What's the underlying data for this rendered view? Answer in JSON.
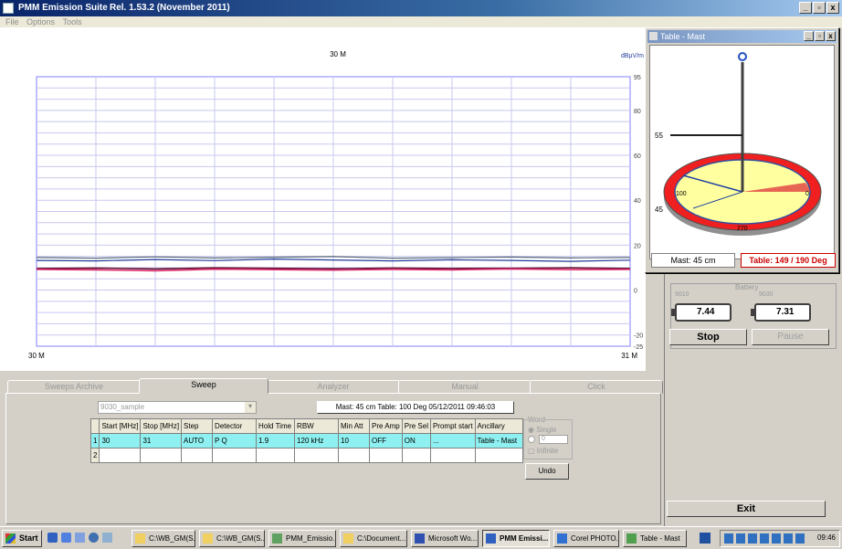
{
  "window": {
    "title": "PMM Emission Suite",
    "release": "Rel. 1.53.2 (November 2011)"
  },
  "menu": [
    "File",
    "Options",
    "Tools"
  ],
  "chart": {
    "top_center_label": "30 M",
    "unit_label": "dBµV/m",
    "y_ticks": [
      "95",
      "80",
      "60",
      "40",
      "20",
      "0",
      "-20",
      "-25"
    ],
    "x_start_label": "30 M",
    "x_end_label": "31 M",
    "colors": {
      "grid": "#8080ff",
      "hgrid": "#c8c8f0",
      "trace_gray": "#5a6a7a",
      "trace_blue": "#203a9a",
      "trace_dark": "#601030",
      "trace_red": "#e03070"
    }
  },
  "chart_data": {
    "type": "line",
    "xlim": [
      30,
      31
    ],
    "ylim": [
      -25,
      95
    ],
    "x": [
      30,
      30.1,
      30.2,
      30.3,
      30.4,
      30.5,
      30.6,
      30.7,
      30.8,
      30.9,
      31
    ],
    "series": [
      {
        "values": [
          14.5,
          14.2,
          14.8,
          14.3,
          14.6,
          14.9,
          14.2,
          14.4,
          14.7,
          14.3,
          14.5
        ]
      },
      {
        "values": [
          13.2,
          13.0,
          13.6,
          13.1,
          13.8,
          13.4,
          13.0,
          13.5,
          13.2,
          12.8,
          13.3
        ]
      },
      {
        "values": [
          9.6,
          9.8,
          9.4,
          9.9,
          9.7,
          9.5,
          9.8,
          9.6,
          9.7,
          9.9,
          9.6
        ]
      },
      {
        "values": [
          9.2,
          9.0,
          8.6,
          9.3,
          9.1,
          8.9,
          9.2,
          9.0,
          9.4,
          9.1,
          9.2
        ]
      }
    ]
  },
  "table_mast": {
    "window_title": "Table - Mast",
    "mast_top_label": "55",
    "mast_bottom_label": "45",
    "table_left_label": "100",
    "table_right_label": "0",
    "table_bottom_label": "270",
    "mast_readout": "Mast: 45 cm",
    "table_readout": "Table: 149 / 190 Deg",
    "colors": {
      "disc_outer": "#f02020",
      "disc_inner": "#ffffa0",
      "readout_red": "#cc0000"
    }
  },
  "right_panel": {
    "battery_label": "Battery",
    "battery_a_label": "9010",
    "battery_a_value": "7.44",
    "battery_b_label": "9030",
    "battery_b_value": "7.31",
    "stop_label": "Stop",
    "pause_label": "Pause",
    "exit_label": "Exit"
  },
  "tabs": [
    "Sweeps Archive",
    "Sweep",
    "Analyzer",
    "Manual",
    "Click"
  ],
  "active_tab": "Sweep",
  "sweep": {
    "preset_value": "9030_sample",
    "status_line": "Mast: 45 cm   Table: 100 Deg  05/12/2011 09:46:03",
    "columns": [
      "Start [MHz]",
      "Stop [MHz]",
      "Step",
      "Detector",
      "Hold Time",
      "RBW",
      "Min Att",
      "Pre Amp",
      "Pre Sel",
      "Prompt start",
      "Ancillary"
    ],
    "rows": [
      {
        "num": "1",
        "cells": [
          "30",
          "31",
          "AUTO",
          "P Q",
          "1.9",
          "120 kHz",
          "10",
          "OFF",
          "ON",
          "...",
          "Table - Mast"
        ]
      },
      {
        "num": "2",
        "cells": [
          "",
          "",
          "",
          "",
          "",
          "",
          "",
          "",
          "",
          "",
          ""
        ]
      }
    ],
    "word_group_label": "Word",
    "single_label": "Single",
    "count_value": "0",
    "infinite_label": "Infinite",
    "undo_label": "Undo"
  },
  "taskbar": {
    "start_label": "Start",
    "items": [
      "C:\\WB_GM(S...",
      "C:\\WB_GM(S...",
      "PMM_Emissio...",
      "C:\\Document...",
      "Microsoft Wo...",
      "PMM Emissi...",
      "Corel PHOTO...",
      "Table - Mast"
    ],
    "clock": "09:46"
  }
}
